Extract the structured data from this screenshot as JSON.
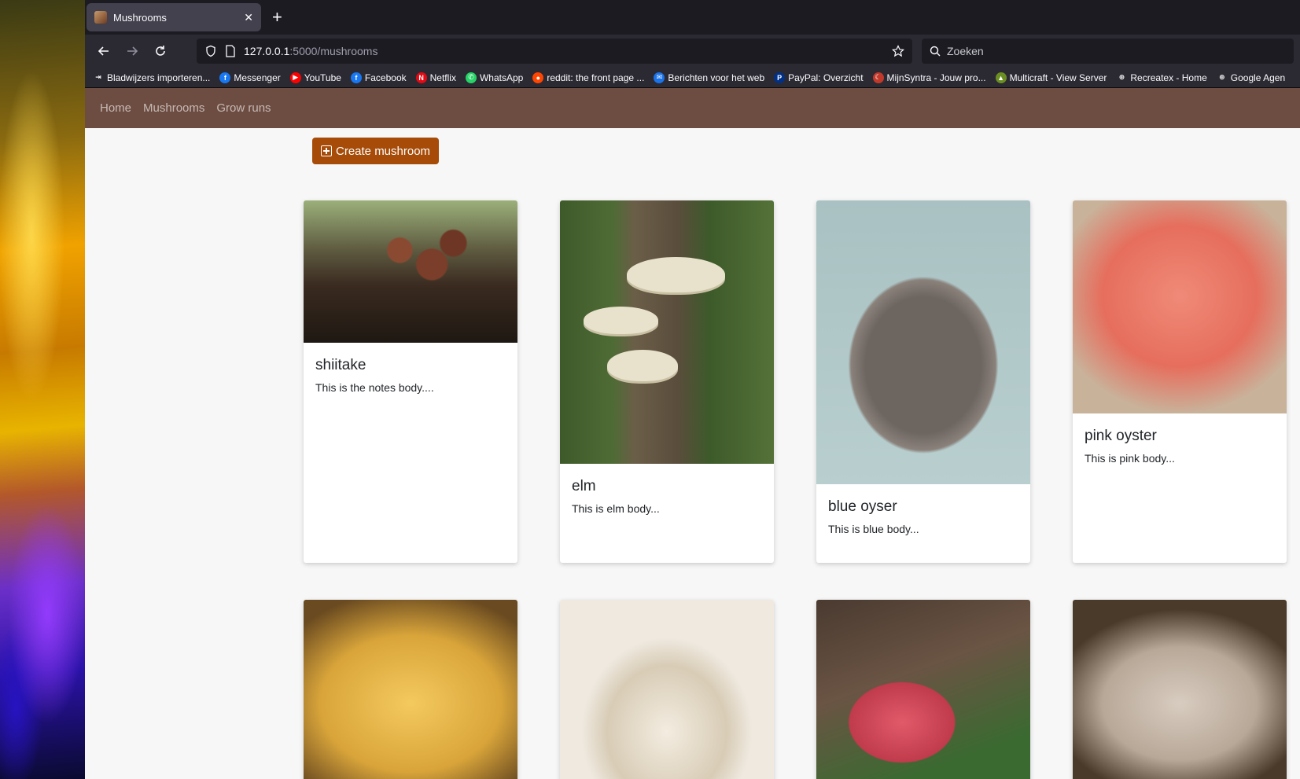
{
  "browser": {
    "tab_title": "Mushrooms",
    "url_host": "127.0.0.1",
    "url_path": ":5000/mushrooms",
    "search_placeholder": "Zoeken",
    "bookmarks": [
      {
        "label": "Bladwijzers importeren...",
        "icon": "import-icon",
        "color": "#2b2a33"
      },
      {
        "label": "Messenger",
        "icon": "facebook-icon",
        "color": "#1877f2"
      },
      {
        "label": "YouTube",
        "icon": "youtube-icon",
        "color": "#ff0000"
      },
      {
        "label": "Facebook",
        "icon": "facebook-icon",
        "color": "#1877f2"
      },
      {
        "label": "Netflix",
        "icon": "netflix-icon",
        "color": "#e50914"
      },
      {
        "label": "WhatsApp",
        "icon": "whatsapp-icon",
        "color": "#25d366"
      },
      {
        "label": "reddit: the front page ...",
        "icon": "reddit-icon",
        "color": "#ff4500"
      },
      {
        "label": "Berichten voor het web",
        "icon": "messages-icon",
        "color": "#1a73e8"
      },
      {
        "label": "PayPal: Overzicht",
        "icon": "paypal-icon",
        "color": "#003087"
      },
      {
        "label": "MijnSyntra - Jouw pro...",
        "icon": "syntra-icon",
        "color": "#c0392b"
      },
      {
        "label": "Multicraft - View Server",
        "icon": "multicraft-icon",
        "color": "#6b8e23"
      },
      {
        "label": "Recreatex - Home",
        "icon": "globe-icon",
        "color": "#2b2a33"
      },
      {
        "label": "Google Agen",
        "icon": "globe-icon",
        "color": "#2b2a33"
      }
    ]
  },
  "app": {
    "nav": [
      "Home",
      "Mushrooms",
      "Grow runs"
    ],
    "create_label": "Create mushroom",
    "cards": [
      {
        "title": "shiitake",
        "body": "This is the notes body...."
      },
      {
        "title": "elm",
        "body": "This is elm body..."
      },
      {
        "title": "blue oyser",
        "body": "This is blue body..."
      },
      {
        "title": "pink oyster",
        "body": "This is pink body..."
      },
      {
        "title": "",
        "body": ""
      },
      {
        "title": "",
        "body": ""
      },
      {
        "title": "",
        "body": ""
      },
      {
        "title": "",
        "body": ""
      }
    ]
  },
  "colors": {
    "navbar_brown": "#6d4c41",
    "create_button": "#a64b08"
  }
}
